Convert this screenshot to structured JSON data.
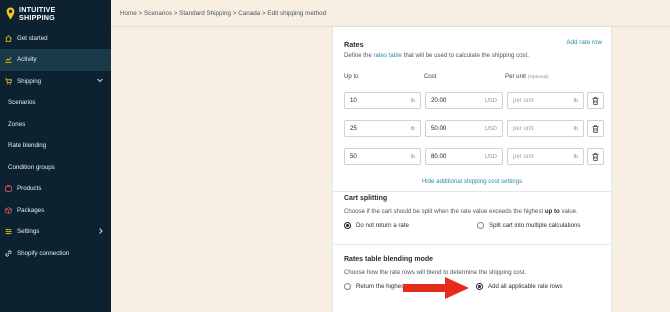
{
  "sidebar": {
    "logo_line1": "INTUITIVE",
    "logo_line2": "SHIPPING",
    "items": [
      {
        "label": "Get started"
      },
      {
        "label": "Activity"
      },
      {
        "label": "Shipping"
      },
      {
        "label": "Scenarios"
      },
      {
        "label": "Zones"
      },
      {
        "label": "Rate blending"
      },
      {
        "label": "Condition groups"
      },
      {
        "label": "Products"
      },
      {
        "label": "Packages"
      },
      {
        "label": "Settings"
      },
      {
        "label": "Shopify connection"
      }
    ]
  },
  "breadcrumb": "Home > Scenarios > Standard Shipping > Canada > Edit shipping method",
  "rates": {
    "title": "Rates",
    "add_label": "Add rate row",
    "desc_prefix": "Define the ",
    "desc_link": "rates table",
    "desc_suffix": " that will be used to calculate the shipping cost.",
    "col_up_to": "Up to",
    "col_cost": "Cost",
    "col_per_unit": "Per unit",
    "col_optional": "(Optional)",
    "rows": [
      {
        "up_to": "10",
        "up_unit": "lb",
        "cost": "20.00",
        "cost_unit": "USD",
        "per_unit_ph": "per unit",
        "per_unit_unit": "lb"
      },
      {
        "up_to": "25",
        "up_unit": "lb",
        "cost": "50.00",
        "cost_unit": "USD",
        "per_unit_ph": "per unit",
        "per_unit_unit": "lb"
      },
      {
        "up_to": "50",
        "up_unit": "lb",
        "cost": "80.00",
        "cost_unit": "USD",
        "per_unit_ph": "per unit",
        "per_unit_unit": "lb"
      }
    ],
    "hide_link": "Hide additional shipping cost settings"
  },
  "cart_splitting": {
    "title": "Cart splitting",
    "desc_prefix": "Choose if the cart should be split when the rate value exceeds the highest ",
    "desc_bold": "up to",
    "desc_suffix": " value.",
    "opt1": "Do not return a rate",
    "opt2": "Split cart into multiple calculations"
  },
  "blending": {
    "title": "Rates table blending mode",
    "desc": "Choose how the rate rows will blend to determine the shipping cost.",
    "opt1": "Return the highest",
    "opt2": "Add all applicable rate rows"
  },
  "colors": {
    "sidebar_bg": "#0c2230",
    "page_bg": "#f6efe2",
    "link": "#2d8ba7",
    "arrow": "#e52b1b",
    "logo_accent": "#f2c618"
  }
}
